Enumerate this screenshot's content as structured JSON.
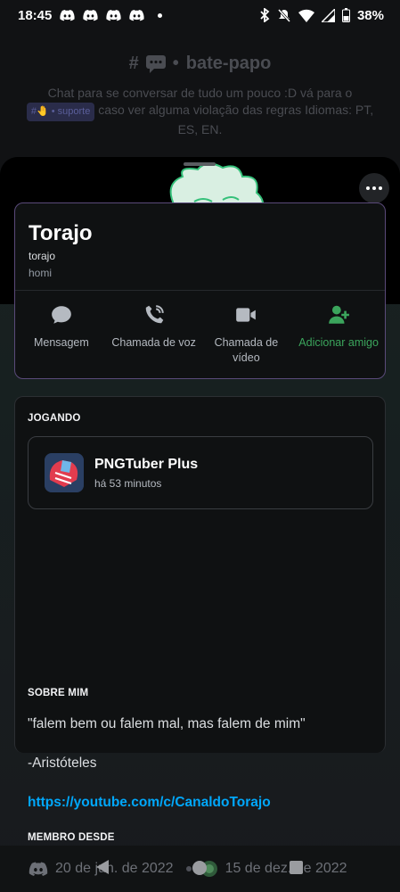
{
  "status_bar": {
    "time": "18:45",
    "battery": "38%"
  },
  "channel": {
    "title": "bate-papo",
    "topic_before": "Chat para se conversar de tudo um pouco :D vá para o",
    "topic_chip": "suporte",
    "topic_after": "caso ver alguma violação das regras Idiomas: PT, ES, EN."
  },
  "profile": {
    "display_name": "Torajo",
    "username": "torajo",
    "pronouns": "homi",
    "actions": [
      {
        "label": "Mensagem"
      },
      {
        "label": "Chamada de voz"
      },
      {
        "label": "Chamada de vídeo"
      },
      {
        "label": "Adicionar amigo"
      }
    ]
  },
  "activity": {
    "header": "JOGANDO",
    "app_name": "PNGTuber Plus",
    "elapsed": "há 53 minutos"
  },
  "about": {
    "header": "SOBRE MIM",
    "quote": "\"falem bem ou falem mal, mas falem de mim\"",
    "attribution": "-Aristóteles",
    "link": "https://youtube.com/c/CanaldoTorajo"
  },
  "member_since": {
    "header": "MEMBRO DESDE",
    "discord_date": "20 de jun. de 2022",
    "server_date": "15 de dez. de 2022"
  },
  "colors": {
    "accent_green": "#3ba55c",
    "link_blue": "#00a8fc",
    "dnd_red": "#e5484d"
  }
}
